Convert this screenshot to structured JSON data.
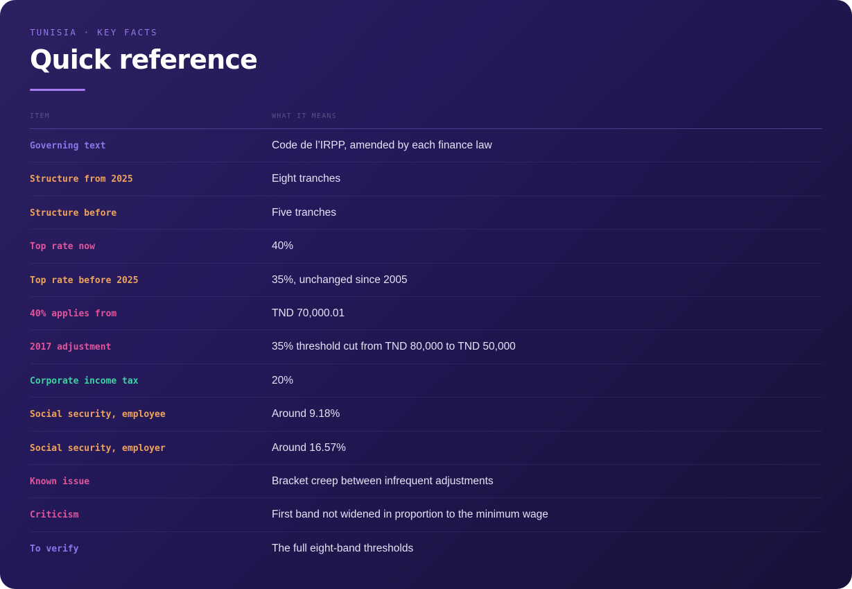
{
  "header": {
    "eyebrow": "Tunisia · Key facts",
    "title": "Quick reference"
  },
  "table": {
    "columns": {
      "item": "Item",
      "meaning": "What it means"
    },
    "rows": [
      {
        "item": "Governing text",
        "meaning": "Code de l’IRPP, amended by each finance law"
      },
      {
        "item": "Structure from 2025",
        "meaning": "Eight tranches"
      },
      {
        "item": "Structure before",
        "meaning": "Five tranches"
      },
      {
        "item": "Top rate now",
        "meaning": "40%"
      },
      {
        "item": "Top rate before 2025",
        "meaning": "35%, unchanged since 2005"
      },
      {
        "item": "40% applies from",
        "meaning": "TND 70,000.01"
      },
      {
        "item": "2017 adjustment",
        "meaning": "35% threshold cut from TND 80,000 to TND 50,000"
      },
      {
        "item": "Corporate income tax",
        "meaning": "20%"
      },
      {
        "item": "Social security, employee",
        "meaning": "Around 9.18%"
      },
      {
        "item": "Social security, employer",
        "meaning": "Around 16.57%"
      },
      {
        "item": "Known issue",
        "meaning": "Bracket creep between infrequent adjustments"
      },
      {
        "item": "Criticism",
        "meaning": "First band not widened in proportion to the minimum wage"
      },
      {
        "item": "To verify",
        "meaning": "The full eight-band thresholds"
      }
    ]
  },
  "colors": {
    "background": "#24195a",
    "accent": "#a77cf2",
    "violet": "#8a76ea",
    "amber": "#f0a35a",
    "pink": "#e3559b",
    "green": "#3ed1a0"
  }
}
